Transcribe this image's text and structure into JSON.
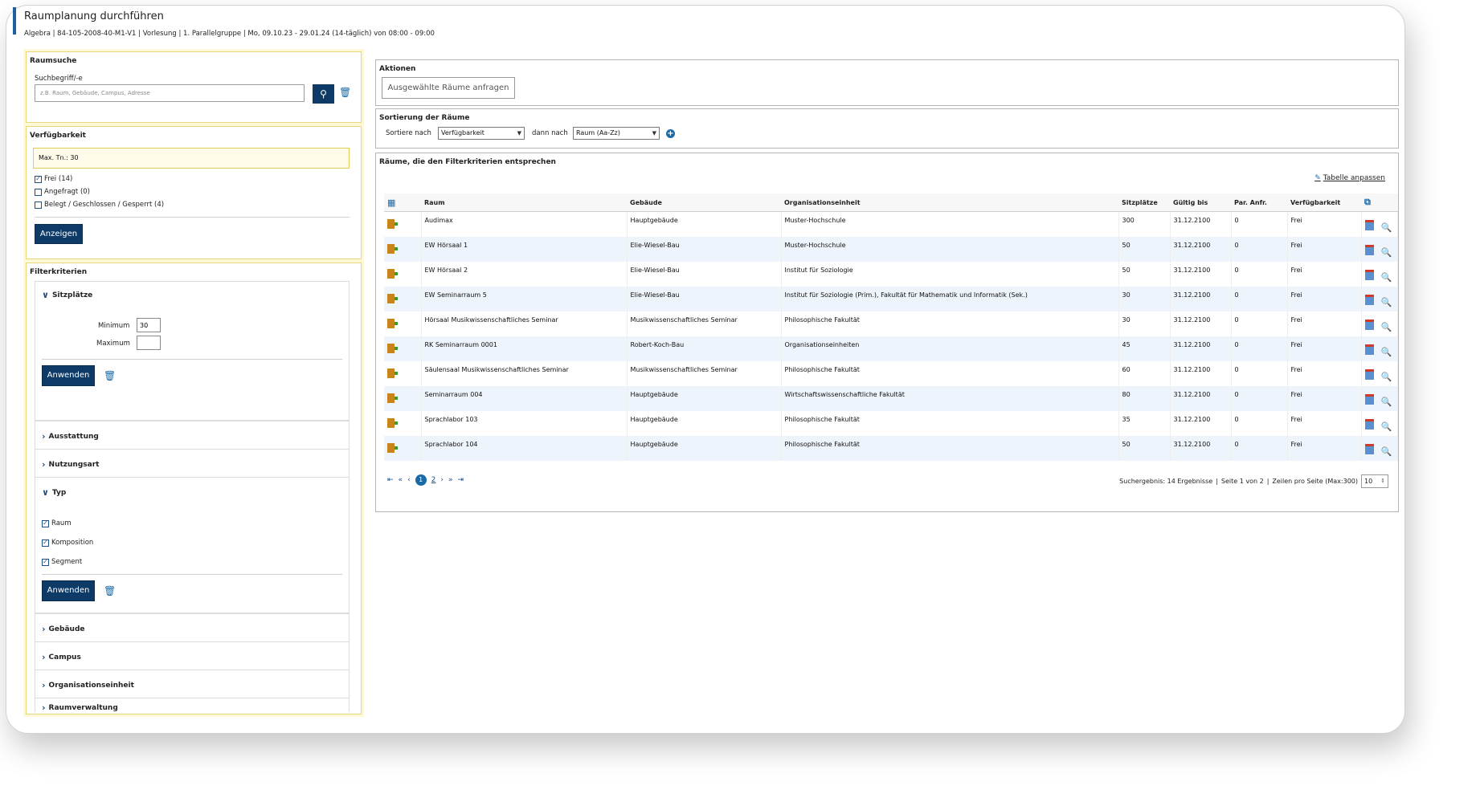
{
  "header": {
    "title": "Raumplanung durchführen",
    "subtitle": "Algebra | 84-105-2008-40-M1-V1 | Vorlesung | 1. Parallelgruppe | Mo, 09.10.23 - 29.01.24 (14-täglich) von 08:00 - 09:00"
  },
  "roomsearch": {
    "title": "Raumsuche",
    "label": "Suchbegriff/-e",
    "placeholder": "z.B. Raum, Gebäude, Campus, Adresse",
    "value": ""
  },
  "availability": {
    "title": "Verfügbarkeit",
    "max_text": "Max. Tn.: 30",
    "options": [
      {
        "label": "Frei (14)",
        "checked": true
      },
      {
        "label": "Angefragt (0)",
        "checked": false
      },
      {
        "label": "Belegt / Geschlossen / Gesperrt (4)",
        "checked": false
      }
    ],
    "show_button": "Anzeigen"
  },
  "filter": {
    "title": "Filterkriterien",
    "seats": {
      "label": "Sitzplätze",
      "min_label": "Minimum",
      "min_value": "30",
      "max_label": "Maximum",
      "max_value": "",
      "apply": "Anwenden"
    },
    "equipment": "Ausstattung",
    "usage": "Nutzungsart",
    "type": {
      "label": "Typ",
      "options": [
        {
          "label": "Raum",
          "checked": true
        },
        {
          "label": "Komposition",
          "checked": true
        },
        {
          "label": "Segment",
          "checked": true
        }
      ],
      "apply": "Anwenden"
    },
    "building": "Gebäude",
    "campus": "Campus",
    "orgunit": "Organisationseinheit",
    "roommgmt": "Raumverwaltung"
  },
  "actions": {
    "title": "Aktionen",
    "request_button": "Ausgewählte Räume anfragen"
  },
  "sorting": {
    "title": "Sortierung der Räume",
    "sort_label": "Sortiere nach",
    "sort_value": "Verfügbarkeit",
    "then_label": "dann nach",
    "then_value": "Raum (Aa-Zz)"
  },
  "results": {
    "title": "Räume, die den Filterkriterien entsprechen",
    "edit_table": "Tabelle anpassen",
    "columns": [
      "Raum",
      "Gebäude",
      "Organisationseinheit",
      "Sitzplätze",
      "Gültig bis",
      "Par. Anfr.",
      "Verfügbarkeit"
    ],
    "rows": [
      [
        "Audimax",
        "Hauptgebäude",
        "Muster-Hochschule",
        "300",
        "31.12.2100",
        "0",
        "Frei"
      ],
      [
        "EW Hörsaal 1",
        "Elie-Wiesel-Bau",
        "Muster-Hochschule",
        "50",
        "31.12.2100",
        "0",
        "Frei"
      ],
      [
        "EW Hörsaal 2",
        "Elie-Wiesel-Bau",
        "Institut für Soziologie",
        "50",
        "31.12.2100",
        "0",
        "Frei"
      ],
      [
        "EW Seminarraum 5",
        "Elie-Wiesel-Bau",
        "Institut für Soziologie (Prim.), Fakultät für Mathematik und Informatik (Sek.)",
        "30",
        "31.12.2100",
        "0",
        "Frei"
      ],
      [
        "Hörsaal Musikwissenschaftliches Seminar",
        "Musikwissenschaftliches Seminar",
        "Philosophische Fakultät",
        "30",
        "31.12.2100",
        "0",
        "Frei"
      ],
      [
        "RK Seminarraum 0001",
        "Robert-Koch-Bau",
        "Organisationseinheiten",
        "45",
        "31.12.2100",
        "0",
        "Frei"
      ],
      [
        "Säulensaal Musikwissenschaftliches Seminar",
        "Musikwissenschaftliches Seminar",
        "Philosophische Fakultät",
        "60",
        "31.12.2100",
        "0",
        "Frei"
      ],
      [
        "Seminarraum 004",
        "Hauptgebäude",
        "Wirtschaftswissenschaftliche Fakultät",
        "80",
        "31.12.2100",
        "0",
        "Frei"
      ],
      [
        "Sprachlabor 103",
        "Hauptgebäude",
        "Philosophische Fakultät",
        "35",
        "31.12.2100",
        "0",
        "Frei"
      ],
      [
        "Sprachlabor 104",
        "Hauptgebäude",
        "Philosophische Fakultät",
        "50",
        "31.12.2100",
        "0",
        "Frei"
      ]
    ],
    "pager": {
      "current": "1",
      "next": "2"
    },
    "summary": "Suchergebnis: 14 Ergebnisse",
    "page_info": "Seite 1 von 2",
    "rows_label": "Zeilen pro Seite (Max:300)",
    "rows_value": "10"
  }
}
